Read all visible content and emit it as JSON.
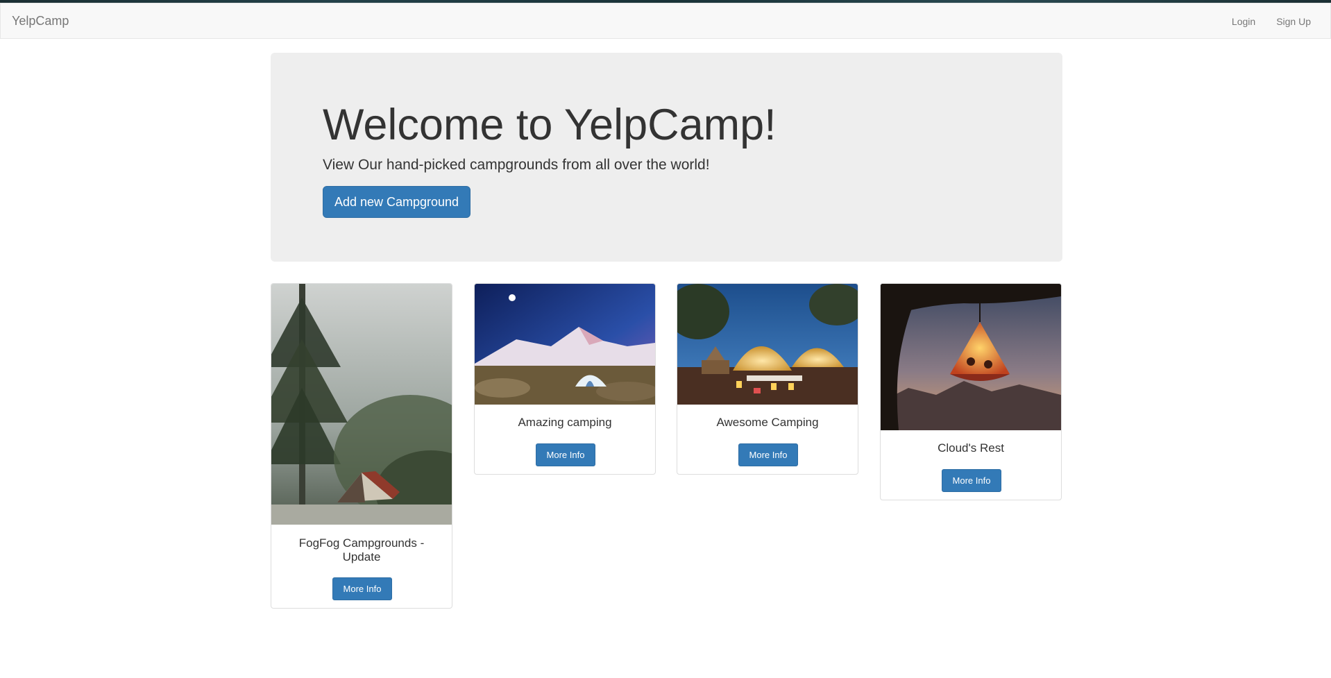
{
  "navbar": {
    "brand": "YelpCamp",
    "links": [
      "Login",
      "Sign Up"
    ]
  },
  "jumbotron": {
    "title": "Welcome to YelpCamp!",
    "subtitle": "View Our hand-picked campgrounds from all over the world!",
    "button_label": "Add new Campground"
  },
  "campgrounds": [
    {
      "name": "FogFog Campgrounds - Update",
      "button_label": "More Info"
    },
    {
      "name": "Amazing camping",
      "button_label": "More Info"
    },
    {
      "name": "Awesome Camping",
      "button_label": "More Info"
    },
    {
      "name": "Cloud's Rest",
      "button_label": "More Info"
    }
  ],
  "colors": {
    "primary": "#337ab7",
    "navbar_bg": "#f8f8f8",
    "jumbotron_bg": "#eeeeee"
  }
}
